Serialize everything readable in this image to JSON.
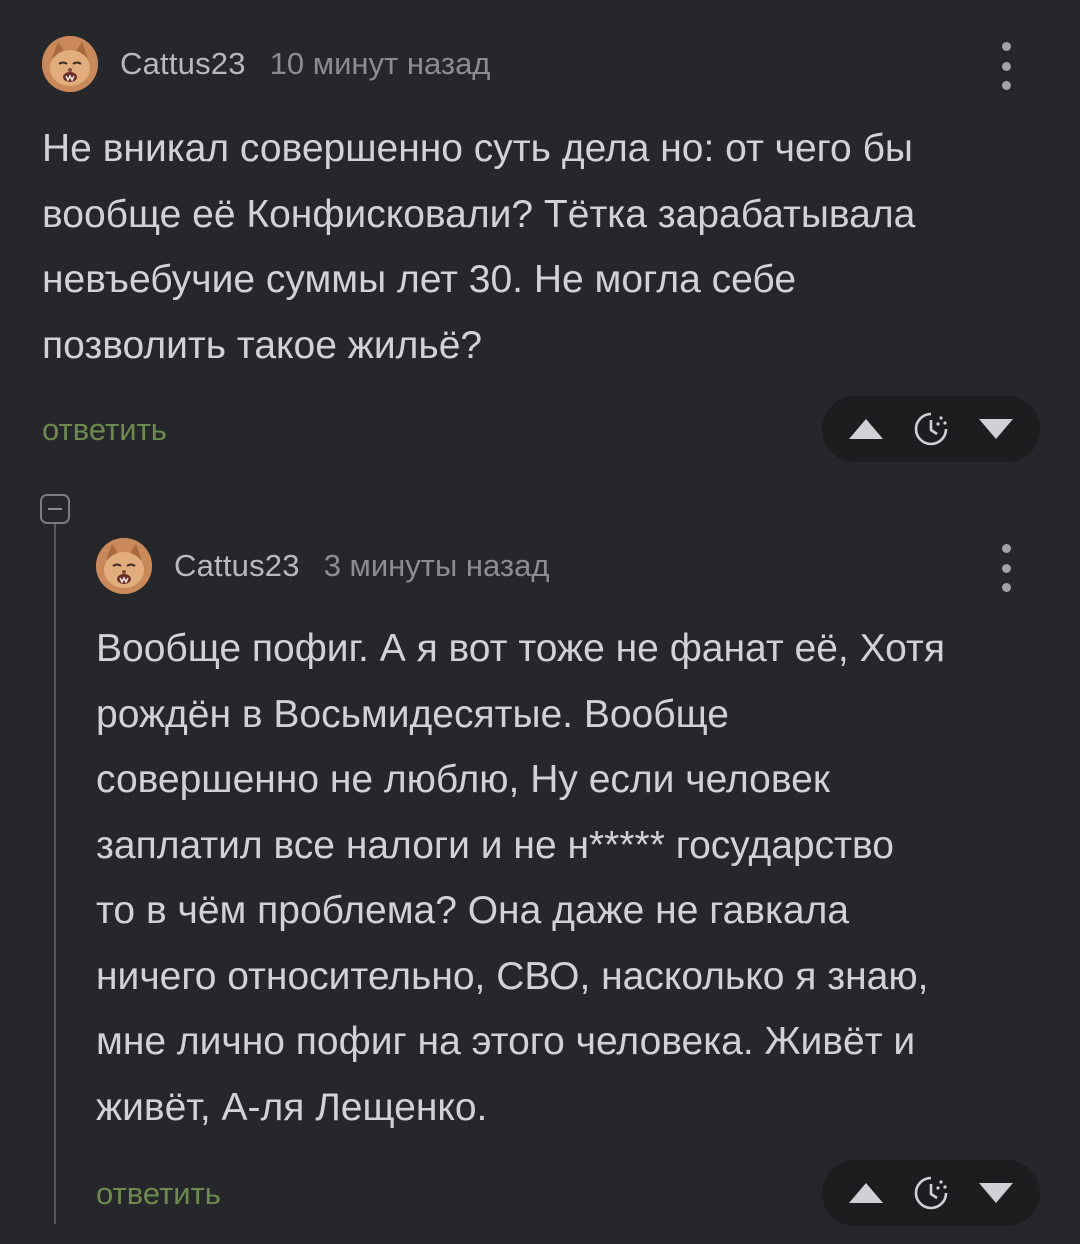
{
  "comments": [
    {
      "username": "Cattus23",
      "time": "10 минут назад",
      "text": "Не вникал совершенно суть дела но: от чего бы\nвообще её Конфисковали? Тётка зарабатывала\nневъебучие суммы лет 30. Не могла себе\nпозволить такое жильё?",
      "reply_label": "ответить"
    },
    {
      "username": "Cattus23",
      "time": "3 минуты назад",
      "text": "Вообще пофиг. А я вот тоже не фанат её, Хотя\nрождён в Восьмидесятые. Вообще\nсовершенно не люблю, Ну если человек\nзаплатил все налоги и не н***** государство\nто в чём проблема? Она даже не гавкала\nничего относительно, СВО, насколько я знаю,\nмне лично пофиг на этого человека. Живёт и\nживёт, А-ля Лещенко.",
      "reply_label": "ответить"
    }
  ],
  "icons": {
    "avatar": "cat-avatar-icon",
    "more": "more-vertical-icon",
    "upvote": "triangle-up-icon",
    "save": "clock-icon",
    "downvote": "triangle-down-icon",
    "collapse": "minus-square-icon"
  },
  "colors": {
    "background": "#25272a",
    "reply_link": "#6d8a4f",
    "vote_pill": "#1c1d1f"
  }
}
